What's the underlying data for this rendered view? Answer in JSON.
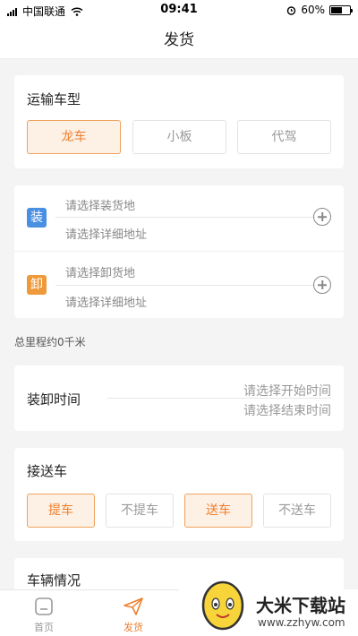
{
  "status": {
    "carrier": "中国联通",
    "time": "09:41",
    "battery": "60%",
    "battery_level": 0.6
  },
  "nav": {
    "title": "发货"
  },
  "vehicle_type": {
    "title": "运输车型",
    "options": [
      {
        "label": "龙车",
        "active": true
      },
      {
        "label": "小板",
        "active": false
      },
      {
        "label": "代驾",
        "active": false
      }
    ]
  },
  "loading": {
    "badge": "装",
    "place_placeholder": "请选择装货地",
    "detail_placeholder": "请选择详细地址"
  },
  "unloading": {
    "badge": "卸",
    "place_placeholder": "请选择卸货地",
    "detail_placeholder": "请选择详细地址"
  },
  "mileage": "总里程约0千米",
  "time_card": {
    "title": "装卸时间",
    "start_placeholder": "请选择开始时间",
    "end_placeholder": "请选择结束时间"
  },
  "pickup": {
    "title": "接送车",
    "options": [
      {
        "label": "提车",
        "active": true
      },
      {
        "label": "不提车",
        "active": false
      },
      {
        "label": "送车",
        "active": true
      },
      {
        "label": "不送车",
        "active": false
      }
    ]
  },
  "vehicle_info": {
    "title": "车辆情况"
  },
  "tabbar": {
    "items": [
      {
        "label": "首页",
        "icon": "home-icon",
        "active": false
      },
      {
        "label": "发货",
        "icon": "send-icon",
        "active": true
      }
    ]
  },
  "watermark": {
    "text": "大米下载站",
    "url": "www.zzhyw.com"
  },
  "colors": {
    "accent": "#ee7e2d",
    "loading_badge": "#4a90e2",
    "unloading_badge": "#ee9a3a"
  }
}
